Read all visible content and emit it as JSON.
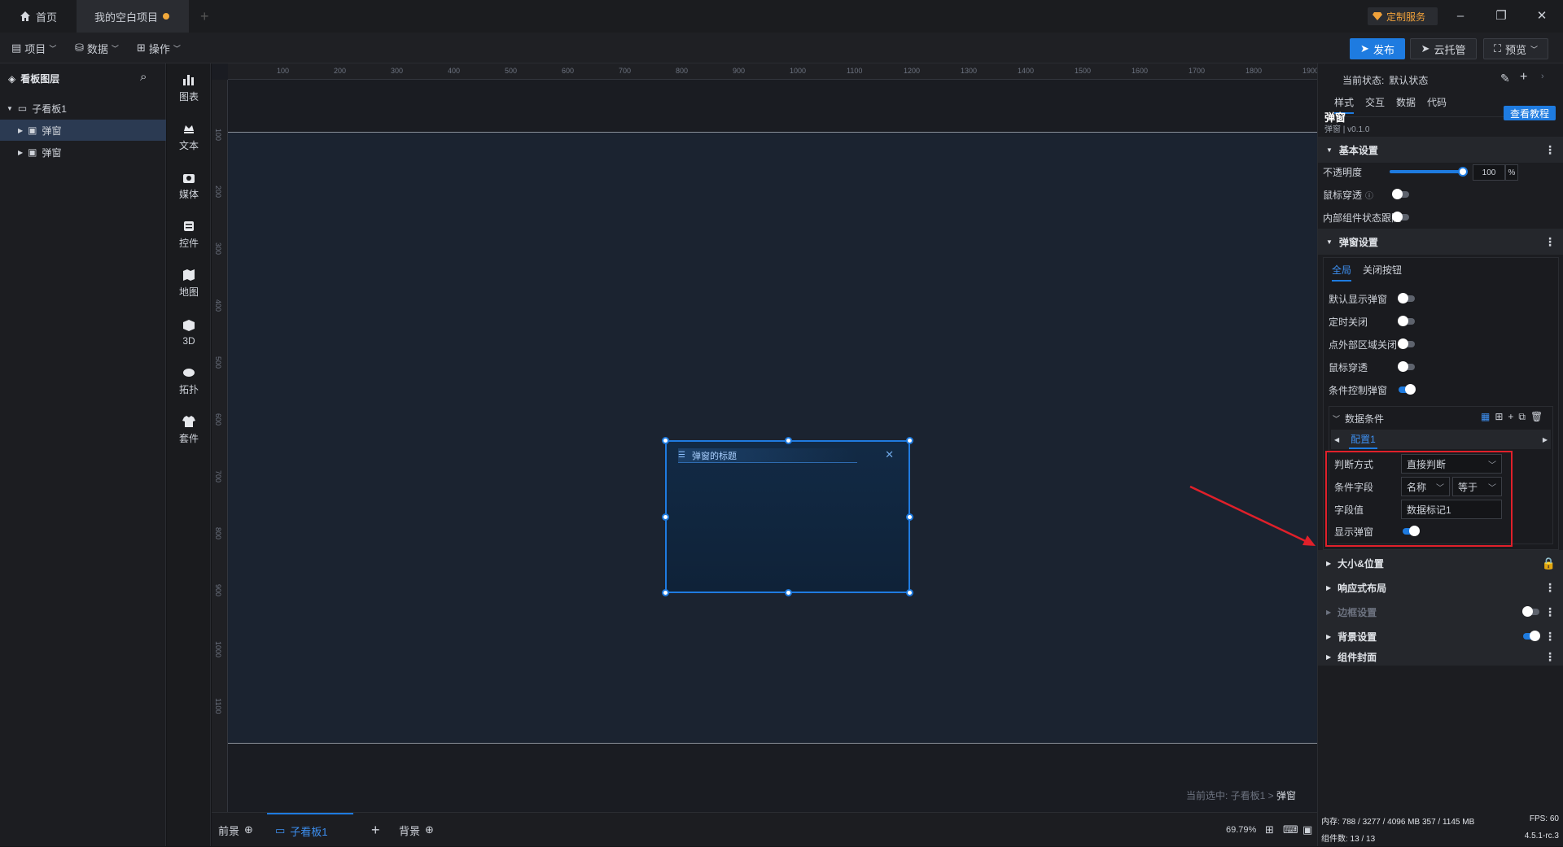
{
  "titlebar": {
    "home_tab": "首页",
    "project_tab": "我的空白项目",
    "service_label": "定制服务"
  },
  "menubar": {
    "project": "项目",
    "data": "数据",
    "operate": "操作",
    "publish": "发布",
    "cloud": "云托管",
    "preview": "预览"
  },
  "layers": {
    "title": "看板图层",
    "root": "子看板1",
    "items": [
      "弹窗",
      "弹窗"
    ]
  },
  "components": [
    "图表",
    "文本",
    "媒体",
    "控件",
    "地图",
    "3D",
    "拓扑",
    "套件"
  ],
  "canvas": {
    "ruler_top": [
      "100",
      "200",
      "300",
      "400",
      "500",
      "600",
      "700",
      "800",
      "900",
      "1000",
      "1100",
      "1200",
      "1300",
      "1400",
      "1500",
      "1600",
      "1700",
      "1800",
      "1900"
    ],
    "ruler_left": [
      "100",
      "200",
      "300",
      "400",
      "500",
      "600",
      "700",
      "800",
      "900",
      "1000",
      "1100"
    ],
    "popup_title": "弹窗的标题",
    "status_prefix": "当前选中: 子看板1 > ",
    "status_current": "弹窗"
  },
  "bottombar": {
    "front": "前景",
    "board": "子看板1",
    "background": "背景",
    "zoom": "69.79%"
  },
  "rpanel": {
    "state_label": "当前状态:",
    "state_value": "默认状态",
    "tabs": [
      "样式",
      "交互",
      "数据",
      "代码"
    ],
    "comp_name": "弹窗",
    "comp_version": "弹窗 | v0.1.0",
    "tutorial": "查看教程",
    "basic": {
      "title": "基本设置",
      "opacity_label": "不透明度",
      "opacity_value": "100",
      "opacity_unit": "%",
      "opacity_fraction": 1.0,
      "mouse_through": "鼠标穿透",
      "inner_follow": "内部组件状态跟随"
    },
    "popup_settings": {
      "title": "弹窗设置",
      "subtabs": [
        "全局",
        "关闭按钮"
      ],
      "default_show": "默认显示弹窗",
      "timed_close": "定时关闭",
      "click_outside_close": "点外部区域关闭",
      "mouse_through": "鼠标穿透",
      "condition_control": "条件控制弹窗",
      "data_condition": "数据条件",
      "config_tab": "配置1",
      "judge_label": "判断方式",
      "judge_value": "直接判断",
      "field_label": "条件字段",
      "field_value": "名称",
      "op_value": "等于",
      "value_label": "字段值",
      "value_value": "数据标记1",
      "show_label": "显示弹窗"
    },
    "sections": [
      "大小&位置",
      "响应式布局",
      "边框设置",
      "背景设置",
      "组件封面"
    ],
    "footer": {
      "memory": "内存: 788 / 3277 / 4096 MB  357 / 1145 MB",
      "fps": "FPS: 60",
      "count": "组件数: 13 / 13",
      "version": "4.5.1-rc.3"
    }
  },
  "colors": {
    "accent": "#1e7be0",
    "annotation": "#e0202a"
  }
}
